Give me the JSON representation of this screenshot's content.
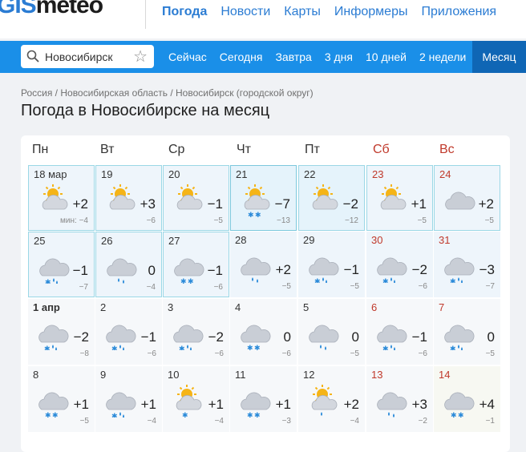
{
  "logo": {
    "part1": "GIS",
    "part2": "meteo"
  },
  "topnav": [
    "Погода",
    "Новости",
    "Карты",
    "Информеры",
    "Приложения"
  ],
  "search": {
    "value": "Новосибирск"
  },
  "tabs": [
    "Сейчас",
    "Сегодня",
    "Завтра",
    "3 дня",
    "10 дней",
    "2 недели",
    "Месяц"
  ],
  "breadcrumb": "Россия / Новосибирская область / Новосибирск (городской округ)",
  "title": "Погода в Новосибирске на месяц",
  "weekdays": [
    "Пн",
    "Вт",
    "Ср",
    "Чт",
    "Пт",
    "Сб",
    "Вс"
  ],
  "min_prefix": "мин: ",
  "colors": {
    "brand": "#2b7cd3",
    "bar": "#1a8fe8",
    "active_tab": "#0f66b5",
    "weekend": "#c0392b"
  },
  "weeks": [
    [
      {
        "date": "18 мар",
        "max": "+2",
        "min": "−4",
        "icon": "partly-cloudy"
      },
      {
        "date": "19",
        "max": "+3",
        "min": "−6",
        "icon": "partly-cloudy"
      },
      {
        "date": "20",
        "max": "−1",
        "min": "−5",
        "icon": "partly-cloudy"
      },
      {
        "date": "21",
        "max": "−7",
        "min": "−13",
        "icon": "partly-cloudy-snow"
      },
      {
        "date": "22",
        "max": "−2",
        "min": "−12",
        "icon": "partly-cloudy"
      },
      {
        "date": "23",
        "max": "+1",
        "min": "−5",
        "icon": "partly-cloudy"
      },
      {
        "date": "24",
        "max": "+2",
        "min": "−5",
        "icon": "cloudy"
      }
    ],
    [
      {
        "date": "25",
        "max": "−1",
        "min": "−7",
        "icon": "cloud-snow-rain"
      },
      {
        "date": "26",
        "max": "0",
        "min": "−4",
        "icon": "cloud-rain"
      },
      {
        "date": "27",
        "max": "−1",
        "min": "−6",
        "icon": "cloud-snow"
      },
      {
        "date": "28",
        "max": "+2",
        "min": "−5",
        "icon": "cloud-rain"
      },
      {
        "date": "29",
        "max": "−1",
        "min": "−5",
        "icon": "cloud-snow-rain"
      },
      {
        "date": "30",
        "max": "−2",
        "min": "−6",
        "icon": "cloud-snow-rain"
      },
      {
        "date": "31",
        "max": "−3",
        "min": "−7",
        "icon": "cloud-snow-rain"
      }
    ],
    [
      {
        "date": "1 апр",
        "max": "−2",
        "min": "−8",
        "icon": "cloud-snow-rain"
      },
      {
        "date": "2",
        "max": "−1",
        "min": "−6",
        "icon": "cloud-snow-rain"
      },
      {
        "date": "3",
        "max": "−2",
        "min": "−6",
        "icon": "cloud-snow-rain"
      },
      {
        "date": "4",
        "max": "0",
        "min": "−6",
        "icon": "cloud-snow"
      },
      {
        "date": "5",
        "max": "0",
        "min": "−5",
        "icon": "cloud-rain"
      },
      {
        "date": "6",
        "max": "−1",
        "min": "−6",
        "icon": "cloud-snow-rain"
      },
      {
        "date": "7",
        "max": "0",
        "min": "−5",
        "icon": "cloud-snow-rain"
      }
    ],
    [
      {
        "date": "8",
        "max": "+1",
        "min": "−5",
        "icon": "cloud-snow"
      },
      {
        "date": "9",
        "max": "+1",
        "min": "−4",
        "icon": "cloud-snow-rain"
      },
      {
        "date": "10",
        "max": "+1",
        "min": "−4",
        "icon": "sun-cloud-snow"
      },
      {
        "date": "11",
        "max": "+1",
        "min": "−3",
        "icon": "cloud-snow"
      },
      {
        "date": "12",
        "max": "+2",
        "min": "−4",
        "icon": "sun-cloud-rain"
      },
      {
        "date": "13",
        "max": "+3",
        "min": "−2",
        "icon": "cloud-rain"
      },
      {
        "date": "14",
        "max": "+4",
        "min": "−1",
        "icon": "cloud-snow"
      }
    ]
  ]
}
